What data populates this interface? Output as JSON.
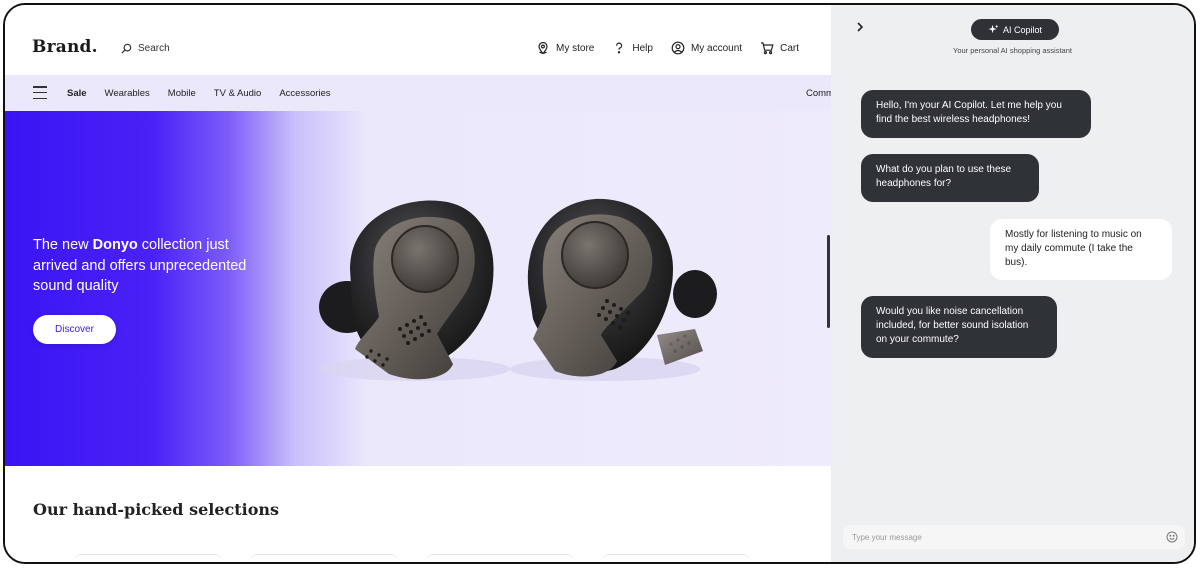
{
  "header": {
    "brand": "Brand.",
    "search_label": "Search",
    "links": {
      "store": "My store",
      "help": "Help",
      "account": "My account",
      "cart": "Cart"
    }
  },
  "categories": {
    "items": [
      "Sale",
      "Wearables",
      "Mobile",
      "TV & Audio",
      "Accessories"
    ],
    "overflow": "Comm"
  },
  "hero": {
    "line_prefix": "The new ",
    "line_bold": "Donyo",
    "line_suffix": " collection just arrived and offers unprecedented sound quality",
    "cta": "Discover"
  },
  "section": {
    "title": "Our hand-picked selections"
  },
  "copilot": {
    "title": "AI Copilot",
    "subtitle": "Your personal AI shopping assistant",
    "messages": [
      {
        "from": "bot",
        "text": "Hello, I'm your AI Copilot. Let me help you find the best wireless headphones!"
      },
      {
        "from": "bot",
        "text": "What do you plan to use these headphones for?"
      },
      {
        "from": "user",
        "text": "Mostly for listening to music on my daily commute (I take the bus)."
      },
      {
        "from": "bot",
        "text": "Would you like noise cancellation included, for better sound isolation on your commute?"
      }
    ],
    "input_placeholder": "Type your message"
  },
  "colors": {
    "accent": "#3a14f4",
    "category_bar": "#ebe8fc",
    "bot_bubble": "#2f3237",
    "panel_bg": "#eeeff1"
  },
  "icons": {
    "search": "search-icon",
    "store": "location-pin-icon",
    "help": "question-mark-icon",
    "account": "user-circle-icon",
    "cart": "cart-icon",
    "menu": "hamburger-menu-icon",
    "collapse": "chevron-right-icon",
    "copilot": "sparkle-icon",
    "emoji": "smiley-icon"
  }
}
